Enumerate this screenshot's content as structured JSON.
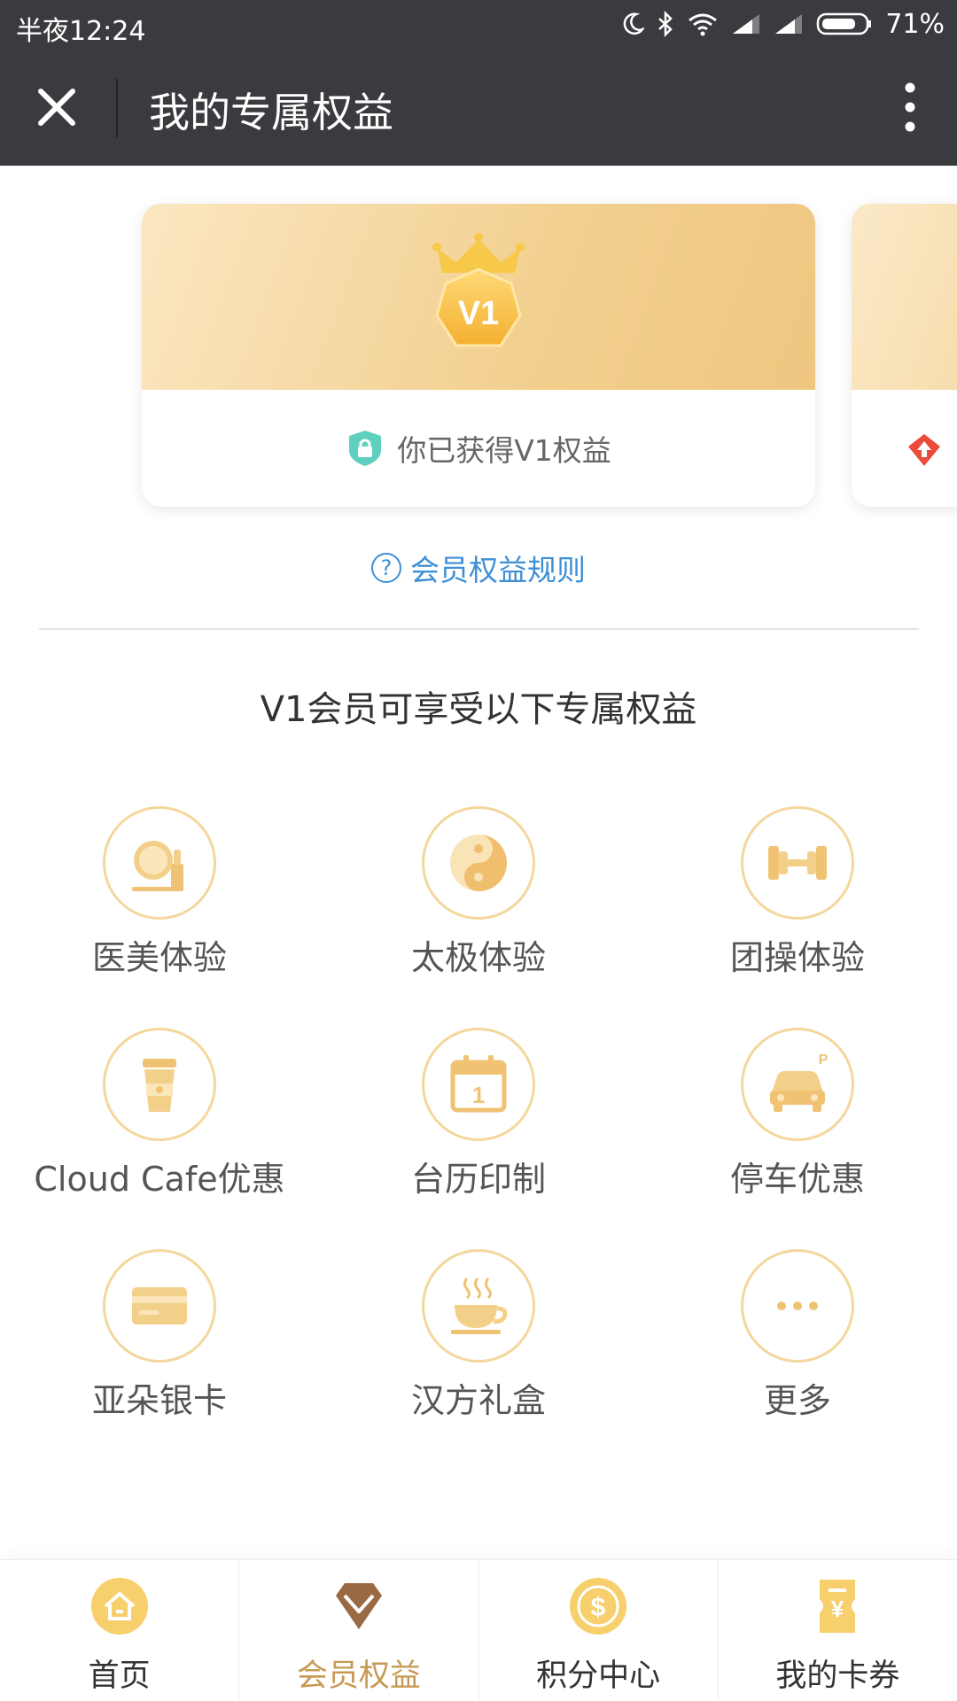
{
  "status_bar": {
    "time": "半夜12:24",
    "battery": "71%"
  },
  "title_bar": {
    "title": "我的专属权益"
  },
  "carousel": {
    "current_card": {
      "level_badge": "V1",
      "status_text": "你已获得V1权益"
    }
  },
  "rules_link": {
    "question_mark": "?",
    "label": "会员权益规则"
  },
  "section_title": "V1会员可享受以下专属权益",
  "benefits": [
    {
      "label": "医美体验",
      "icon": "cosmetics-mirror-icon"
    },
    {
      "label": "太极体验",
      "icon": "yin-yang-icon"
    },
    {
      "label": "团操体验",
      "icon": "dumbbell-icon"
    },
    {
      "label": "Cloud Cafe优惠",
      "icon": "coffee-cup-icon"
    },
    {
      "label": "台历印制",
      "icon": "calendar-icon"
    },
    {
      "label": "停车优惠",
      "icon": "parking-car-icon"
    },
    {
      "label": "亚朵银卡",
      "icon": "bank-card-icon"
    },
    {
      "label": "汉方礼盒",
      "icon": "tea-cup-icon"
    },
    {
      "label": "更多",
      "icon": "more-dots-icon"
    }
  ],
  "tab_bar": {
    "tabs": [
      {
        "label": "首页",
        "icon": "home-icon",
        "active": false
      },
      {
        "label": "会员权益",
        "icon": "diamond-icon",
        "active": true
      },
      {
        "label": "积分中心",
        "icon": "coin-icon",
        "active": false
      },
      {
        "label": "我的卡券",
        "icon": "coupon-icon",
        "active": false
      }
    ]
  },
  "colors": {
    "header_bg": "#3a3b3f",
    "gold": "#f0c878",
    "link_blue": "#3f8fd6",
    "active_tab": "#c79a54"
  }
}
